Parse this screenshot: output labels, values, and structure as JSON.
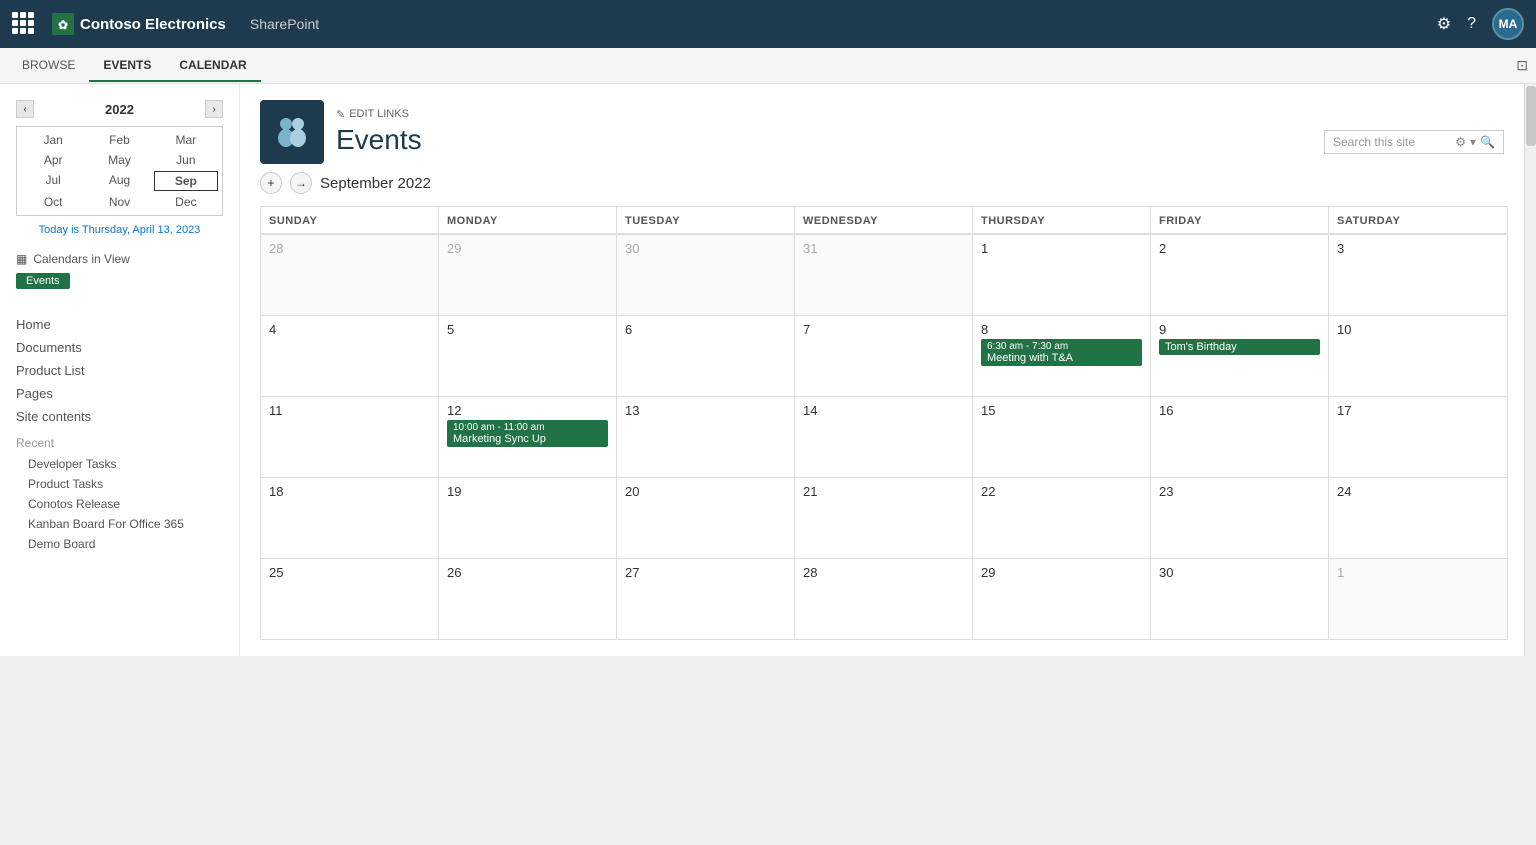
{
  "topNav": {
    "brandName": "Contoso Electronics",
    "sharepoint": "SharePoint",
    "avatarLabel": "MA"
  },
  "ribbon": {
    "tabs": [
      "BROWSE",
      "EVENTS",
      "CALENDAR"
    ],
    "activeTab": "CALENDAR"
  },
  "header": {
    "editLinks": "EDIT LINKS",
    "title": "Events",
    "searchPlaceholder": "Search this site"
  },
  "miniCalendar": {
    "year": "2022",
    "months": [
      "Jan",
      "Feb",
      "Mar",
      "Apr",
      "May",
      "Jun",
      "Jul",
      "Aug",
      "Sep",
      "Oct",
      "Nov",
      "Dec"
    ],
    "selectedMonth": "Sep",
    "todayText": "Today is Thursday, April 13, 2023"
  },
  "calendarsInView": {
    "label": "Calendars in View",
    "badge": "Events"
  },
  "navLinks": {
    "primary": [
      "Home",
      "Documents",
      "Product List",
      "Pages",
      "Site contents"
    ],
    "recentLabel": "Recent",
    "recent": [
      "Developer Tasks",
      "Product Tasks",
      "Conotos Release",
      "Kanban Board For Office 365",
      "Demo Board"
    ]
  },
  "calendarView": {
    "navTitle": "September 2022",
    "dayHeaders": [
      "SUNDAY",
      "MONDAY",
      "TUESDAY",
      "WEDNESDAY",
      "THURSDAY",
      "FRIDAY",
      "SATURDAY"
    ],
    "weeks": [
      [
        {
          "date": "28",
          "otherMonth": true
        },
        {
          "date": "29",
          "otherMonth": true
        },
        {
          "date": "30",
          "otherMonth": true
        },
        {
          "date": "31",
          "otherMonth": true
        },
        {
          "date": "1"
        },
        {
          "date": "2"
        },
        {
          "date": "3"
        }
      ],
      [
        {
          "date": "4"
        },
        {
          "date": "5"
        },
        {
          "date": "6"
        },
        {
          "date": "7"
        },
        {
          "date": "8",
          "event": {
            "time": "6:30 am - 7:30 am",
            "title": "Meeting with T&A"
          }
        },
        {
          "date": "9",
          "event": {
            "title": "Tom's Birthday"
          }
        },
        {
          "date": "10"
        }
      ],
      [
        {
          "date": "11"
        },
        {
          "date": "12",
          "event": {
            "time": "10:00 am - 11:00 am",
            "title": "Marketing Sync Up"
          }
        },
        {
          "date": "13"
        },
        {
          "date": "14"
        },
        {
          "date": "15"
        },
        {
          "date": "16"
        },
        {
          "date": "17"
        }
      ],
      [
        {
          "date": "18"
        },
        {
          "date": "19"
        },
        {
          "date": "20"
        },
        {
          "date": "21"
        },
        {
          "date": "22"
        },
        {
          "date": "23"
        },
        {
          "date": "24"
        }
      ],
      [
        {
          "date": "25"
        },
        {
          "date": "26"
        },
        {
          "date": "27"
        },
        {
          "date": "28"
        },
        {
          "date": "29"
        },
        {
          "date": "30"
        },
        {
          "date": "1",
          "otherMonth": true
        }
      ]
    ]
  }
}
